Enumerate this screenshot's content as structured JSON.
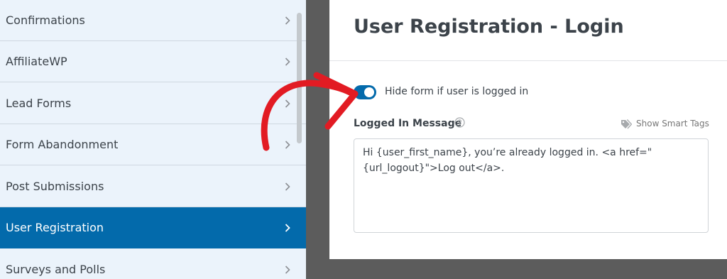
{
  "sidebar": {
    "items": [
      {
        "label": "Confirmations"
      },
      {
        "label": "AffiliateWP"
      },
      {
        "label": "Lead Forms"
      },
      {
        "label": "Form Abandonment"
      },
      {
        "label": "Post Submissions"
      },
      {
        "label": "User Registration",
        "active": true
      },
      {
        "label": "Surveys and Polls"
      }
    ],
    "chevron_icon": "chevron-right-icon"
  },
  "panel": {
    "title": "User Registration - Login",
    "toggle": {
      "label": "Hide form if user is logged in",
      "enabled": true
    },
    "logged_in_message": {
      "label": "Logged In Message",
      "help_icon": "question-circle-icon",
      "smart_tags_label": "Show Smart Tags",
      "smart_tags_icon": "tags-icon",
      "value": "Hi {user_first_name}, you’re already logged in. <a href=\"{url_logout}\">Log out</a>."
    }
  },
  "colors": {
    "accent": "#036aab",
    "sidebar_bg": "#ebf3fb",
    "annotation_arrow": "#e21b23",
    "overlay": "#5c5c5c"
  }
}
